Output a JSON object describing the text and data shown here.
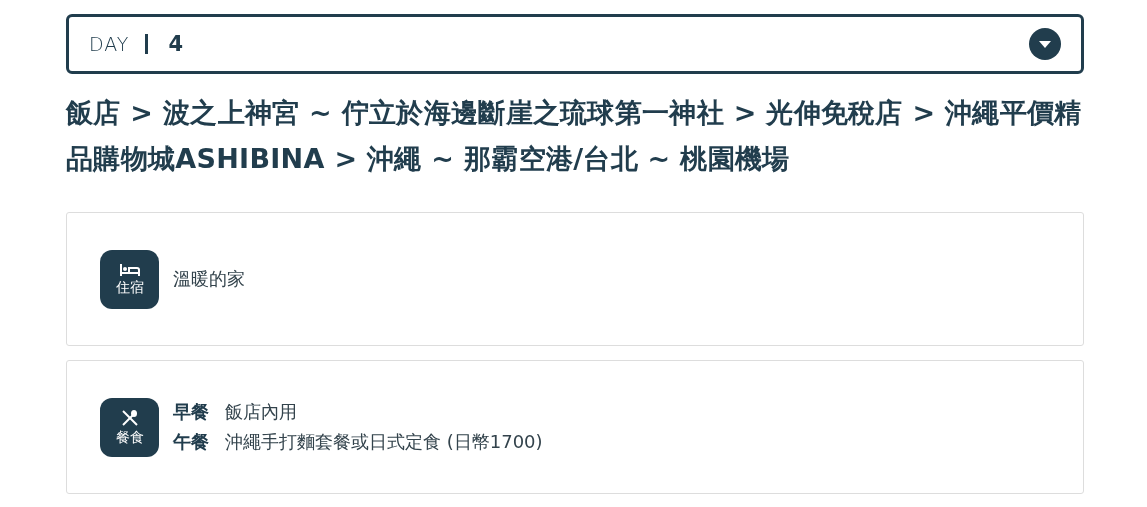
{
  "day_select": {
    "label": "DAY",
    "value": "4"
  },
  "itinerary_title": "飯店 > 波之上神宮 ~ 佇立於海邊斷崖之琉球第一神社 > 光伸免稅店 > 沖繩平價精品購物城ASHIBINA > 沖繩 ~ 那霸空港/台北 ~ 桃園機場",
  "cards": [
    {
      "kind": "lodging",
      "label": "住宿",
      "entries": [
        {
          "text": "溫暖的家"
        }
      ]
    },
    {
      "kind": "meals",
      "label": "餐食",
      "entries": [
        {
          "meal": "早餐",
          "text": "飯店內用"
        },
        {
          "meal": "午餐",
          "text": "沖繩手打麵套餐或日式定食 (日幣1700)"
        }
      ]
    }
  ]
}
